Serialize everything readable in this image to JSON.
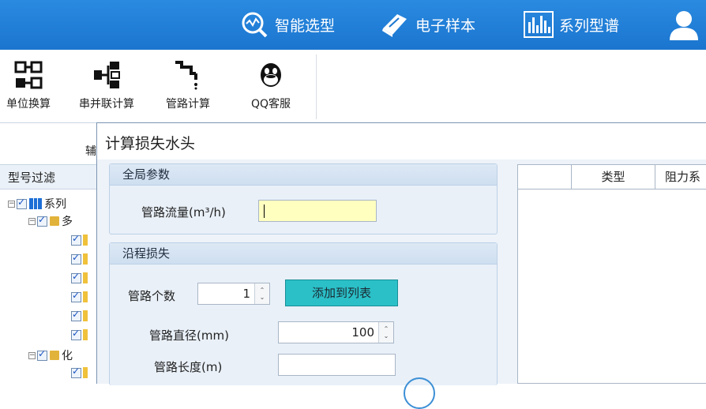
{
  "topbar": {
    "items": [
      {
        "label": "智能选型",
        "icon": "magnifier-chart-icon"
      },
      {
        "label": "电子样本",
        "icon": "book-icon"
      },
      {
        "label": "系列型谱",
        "icon": "bar-chart-icon"
      }
    ],
    "user_icon": "user-icon"
  },
  "ribbon": {
    "buttons": [
      {
        "label": "单位换算",
        "icon": "unit-convert-icon"
      },
      {
        "label": "串并联计算",
        "icon": "series-parallel-icon"
      },
      {
        "label": "管路计算",
        "icon": "pipe-icon"
      },
      {
        "label": "QQ客服",
        "icon": "qq-icon"
      }
    ],
    "partial_label": "辅"
  },
  "left_panel": {
    "header": "型号过滤",
    "tree_label_1": "系列",
    "tree_label_2": "多",
    "tree_label_3": "化"
  },
  "dialog": {
    "title": "计算损失水头",
    "global_group": {
      "title": "全局参数",
      "flow_label": "管路流量(m³/h)",
      "flow_value": ""
    },
    "friction_group": {
      "title": "沿程损失",
      "count_label": "管路个数",
      "count_value": "1",
      "add_button": "添加到列表",
      "diameter_label": "管路直径(mm)",
      "diameter_value": "100",
      "length_label": "管路长度(m)",
      "length_value": ""
    },
    "grid": {
      "columns": [
        "",
        "类型",
        "阻力系"
      ]
    }
  }
}
